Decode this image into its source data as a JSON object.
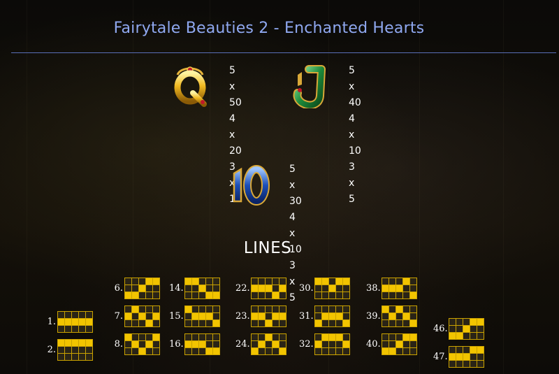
{
  "title": "Fairytale Beauties 2 - Enchanted Hearts",
  "symbols": [
    {
      "name": "Q",
      "pays": [
        "5 x 50",
        "4 x 20",
        "3 x 10"
      ],
      "color": "#e2b01c"
    },
    {
      "name": "J",
      "pays": [
        "5 x 40",
        "4 x 10",
        "3 x 5"
      ],
      "color": "#2fa04a"
    },
    {
      "name": "10",
      "pays": [
        "5 x 30",
        "4 x 10",
        "3 x 5"
      ],
      "color": "#2a5fc8"
    }
  ],
  "lines_title": "LINES",
  "lines": [
    {
      "label": "1.",
      "rows": [
        1,
        1,
        1,
        1,
        1
      ]
    },
    {
      "label": "2.",
      "rows": [
        0,
        0,
        0,
        0,
        0
      ]
    },
    {
      "label": "6.",
      "rows": [
        2,
        2,
        1,
        0,
        0
      ]
    },
    {
      "label": "7.",
      "rows": [
        1,
        0,
        1,
        2,
        1
      ]
    },
    {
      "label": "8.",
      "rows": [
        0,
        1,
        2,
        1,
        0
      ]
    },
    {
      "label": "14.",
      "rows": [
        0,
        0,
        1,
        2,
        2
      ]
    },
    {
      "label": "15.",
      "rows": [
        0,
        1,
        1,
        1,
        2
      ]
    },
    {
      "label": "16.",
      "rows": [
        1,
        1,
        1,
        2,
        2
      ]
    },
    {
      "label": "22.",
      "rows": [
        1,
        1,
        1,
        2,
        1
      ]
    },
    {
      "label": "23.",
      "rows": [
        1,
        1,
        2,
        1,
        1
      ]
    },
    {
      "label": "24.",
      "rows": [
        2,
        1,
        0,
        1,
        2
      ]
    },
    {
      "label": "30.",
      "rows": [
        0,
        0,
        1,
        0,
        0
      ]
    },
    {
      "label": "31.",
      "rows": [
        2,
        1,
        1,
        1,
        2
      ]
    },
    {
      "label": "32.",
      "rows": [
        1,
        0,
        0,
        0,
        1
      ]
    },
    {
      "label": "38.",
      "rows": [
        1,
        1,
        1,
        0,
        2
      ]
    },
    {
      "label": "39.",
      "rows": [
        0,
        1,
        0,
        1,
        2
      ]
    },
    {
      "label": "40.",
      "rows": [
        2,
        2,
        1,
        0,
        0
      ]
    },
    {
      "label": "46.",
      "rows": [
        2,
        2,
        1,
        0,
        0
      ]
    },
    {
      "label": "47.",
      "rows": [
        1,
        1,
        1,
        0,
        0
      ]
    }
  ]
}
